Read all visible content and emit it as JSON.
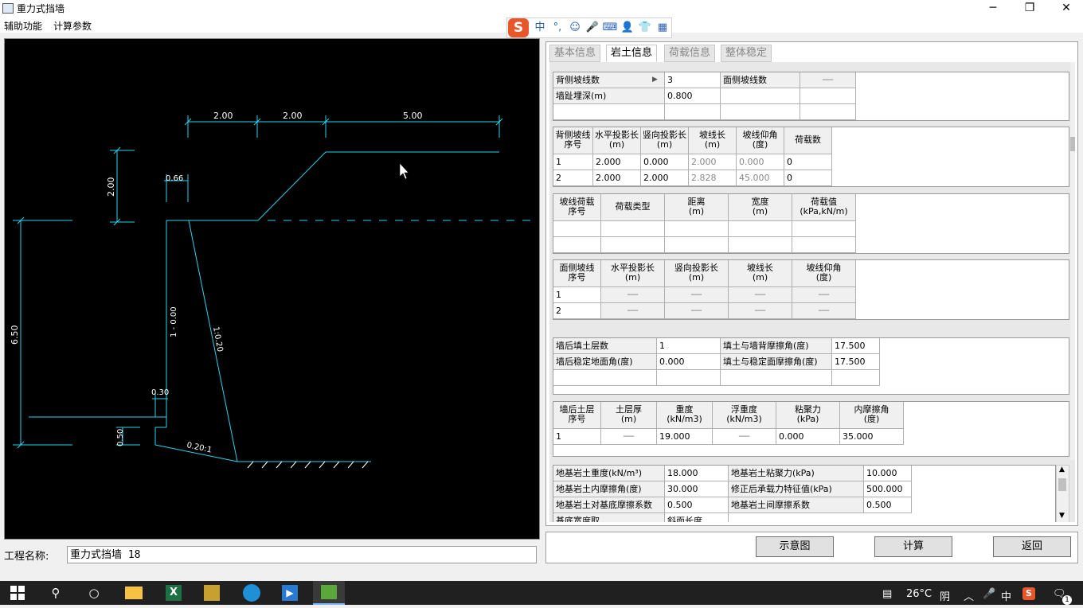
{
  "window": {
    "title": "重力式挡墙",
    "minimize": "─",
    "maximize": "❐",
    "close": "✕"
  },
  "menu": [
    "辅助功能",
    "计算参数"
  ],
  "ime": {
    "logo": "S",
    "items": [
      "中",
      "°,",
      "☺",
      "🎤",
      "⌨",
      "👤",
      "👕",
      "▦"
    ]
  },
  "drawing": {
    "dims_top": [
      "2.00",
      "2.00",
      "5.00"
    ],
    "dim_left_upper": "2.00",
    "dim_top_width": "0.66",
    "dim_height": "6.50",
    "dim_toe": "0.30",
    "dim_toe_height": "0.50",
    "slope_front": "1 - 0.00",
    "slope_back": "1:0.20",
    "slope_base": "0.20:1"
  },
  "project": {
    "label": "工程名称:",
    "value": "重力式挡墙 18"
  },
  "tabs": [
    "基本信息",
    "岩土信息",
    "荷载信息",
    "整体稳定"
  ],
  "active_tab": "岩土信息",
  "grid1": {
    "back_slope_count_label": "背侧坡线数",
    "back_slope_count": "3",
    "front_slope_count_label": "面侧坡线数",
    "front_slope_count": "──",
    "toe_depth_label": "墙趾埋深(m)",
    "toe_depth": "0.800"
  },
  "grid2": {
    "headers": [
      "背侧坡线\n序号",
      "水平投影长\n(m)",
      "竖向投影长\n(m)",
      "坡线长\n(m)",
      "坡线仰角\n(度)",
      "荷载数"
    ],
    "rows": [
      [
        "1",
        "2.000",
        "0.000",
        "2.000",
        "0.000",
        "0"
      ],
      [
        "2",
        "2.000",
        "2.000",
        "2.828",
        "45.000",
        "0"
      ]
    ]
  },
  "grid3": {
    "headers": [
      "坡线荷载\n序号",
      "荷载类型",
      "距离\n(m)",
      "宽度\n(m)",
      "荷载值\n(kPa,kN/m)"
    ]
  },
  "grid4": {
    "headers": [
      "面侧坡线\n序号",
      "水平投影长\n(m)",
      "竖向投影长\n(m)",
      "坡线长\n(m)",
      "坡线仰角\n(度)"
    ],
    "rows": [
      [
        "1",
        "──",
        "──",
        "──",
        "──"
      ],
      [
        "2",
        "──",
        "──",
        "──",
        "──"
      ]
    ]
  },
  "grid5": {
    "fill_layers_label": "墙后填土层数",
    "fill_layers": "1",
    "fill_back_friction_label": "填土与墙背摩擦角(度)",
    "fill_back_friction": "17.500",
    "stable_angle_label": "墙后稳定地面角(度)",
    "stable_angle": "0.000",
    "stable_friction_label": "填土与稳定面摩擦角(度)",
    "stable_friction": "17.500"
  },
  "grid6": {
    "headers": [
      "墙后土层\n序号",
      "土层厚\n(m)",
      "重度\n(kN/m3)",
      "浮重度\n(kN/m3)",
      "粘聚力\n(kPa)",
      "内摩擦角\n(度)"
    ],
    "rows": [
      [
        "1",
        "──",
        "19.000",
        "──",
        "0.000",
        "35.000"
      ]
    ]
  },
  "grid7": {
    "rows": [
      [
        "地基岩土重度(kN/m³)",
        "18.000",
        "地基岩土粘聚力(kPa)",
        "10.000"
      ],
      [
        "地基岩土内摩擦角(度)",
        "30.000",
        "修正后承载力特征值(kPa)",
        "500.000"
      ],
      [
        "地基岩土对基底摩擦系数",
        "0.500",
        "地基岩土间摩擦系数",
        "0.500"
      ],
      [
        "基底宽度取",
        "斜面长度",
        "",
        " "
      ]
    ]
  },
  "buttons": {
    "diagram": "示意图",
    "calc": "计算",
    "back": "返回"
  },
  "taskbar": {
    "temp": "26°C",
    "weather": "阴",
    "ime": "中",
    "notif": "1"
  }
}
